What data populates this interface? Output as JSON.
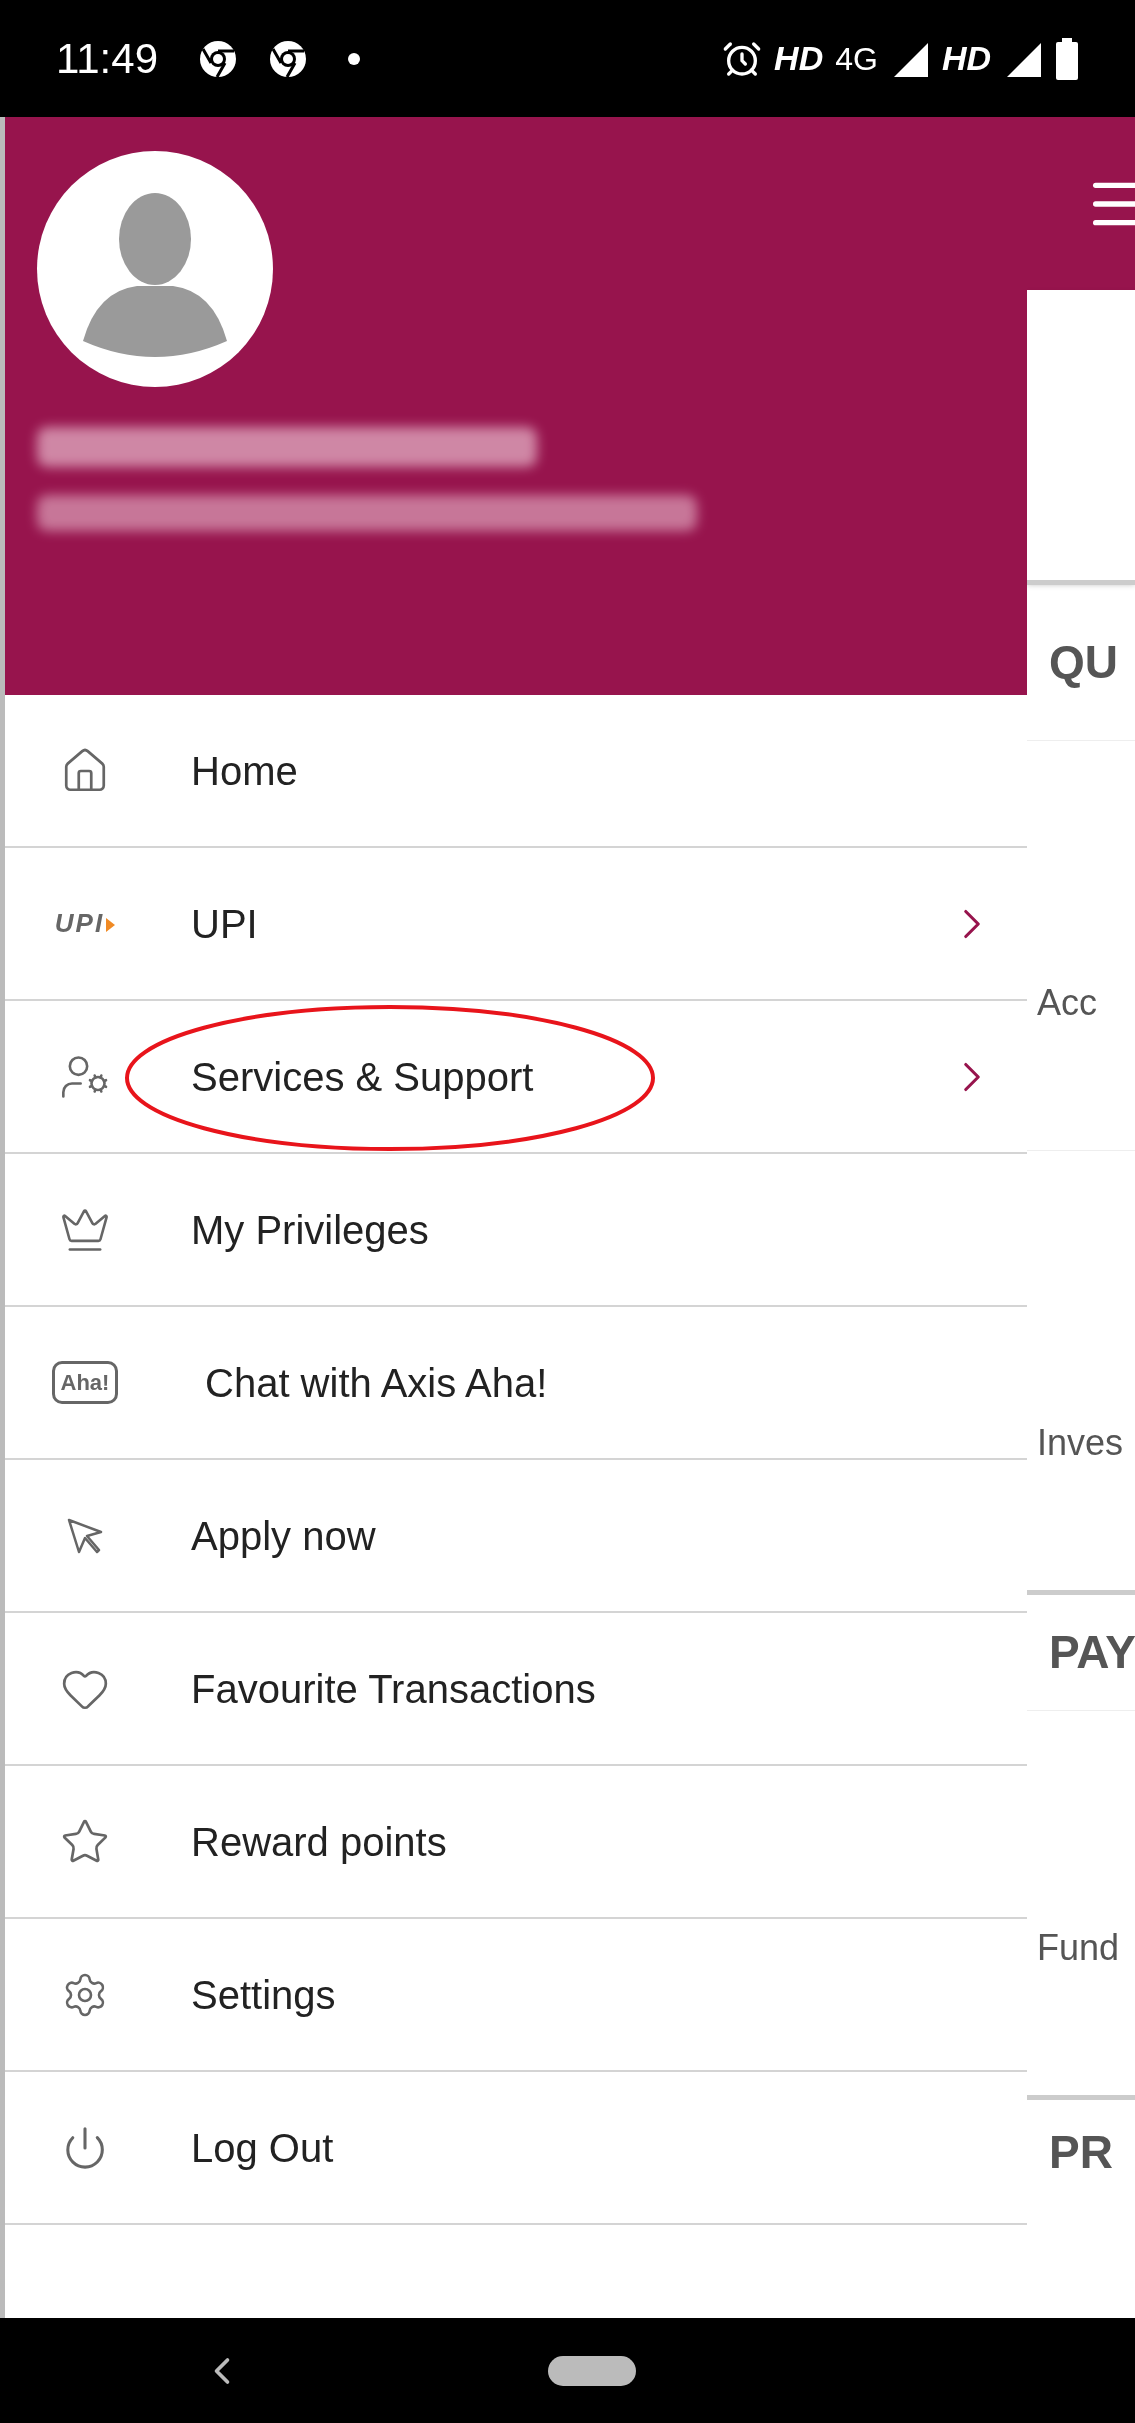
{
  "status_bar": {
    "time": "11:49",
    "indicators": [
      "HD",
      "4G",
      "HD"
    ]
  },
  "drawer": {
    "items": [
      {
        "kind": "home",
        "label": "Home",
        "has_arrow": false
      },
      {
        "kind": "upi",
        "label": "UPI",
        "logo": "UPI",
        "has_arrow": true
      },
      {
        "kind": "services",
        "label": "Services & Support",
        "has_arrow": true,
        "annotated": true
      },
      {
        "kind": "privileges",
        "label": "My Privileges",
        "has_arrow": false
      },
      {
        "kind": "chat",
        "label": "Chat with Axis Aha!",
        "logo": "Aha!",
        "has_arrow": false
      },
      {
        "kind": "apply",
        "label": "Apply now",
        "has_arrow": false
      },
      {
        "kind": "favourite",
        "label": "Favourite Transactions",
        "has_arrow": false
      },
      {
        "kind": "reward",
        "label": "Reward points",
        "has_arrow": false
      },
      {
        "kind": "settings",
        "label": "Settings",
        "has_arrow": false
      },
      {
        "kind": "logout",
        "label": "Log Out",
        "has_arrow": false
      }
    ]
  },
  "background_page": {
    "sections": [
      {
        "kind": "header",
        "label": "QU"
      },
      {
        "kind": "tile",
        "label": "Acc"
      },
      {
        "kind": "tile",
        "label": "Inves"
      },
      {
        "kind": "header",
        "label": "PAY"
      },
      {
        "kind": "tile",
        "label": "Fund"
      },
      {
        "kind": "header",
        "label": "PR"
      }
    ]
  }
}
